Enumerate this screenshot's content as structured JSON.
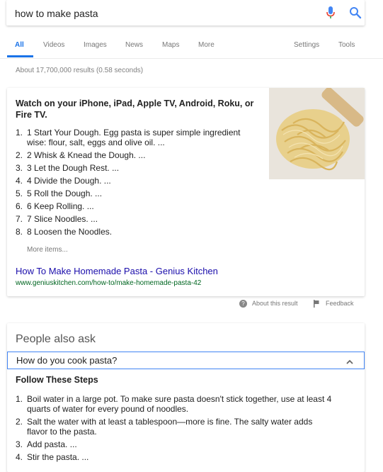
{
  "search": {
    "query": "how to make pasta"
  },
  "colors": {
    "accent": "#1a73e8",
    "link": "#1a0dab",
    "url": "#006621",
    "mic_blue": "#4285f4",
    "mic_red": "#ea4335"
  },
  "tabs": [
    {
      "label": "All",
      "active": true
    },
    {
      "label": "Videos"
    },
    {
      "label": "Images"
    },
    {
      "label": "News"
    },
    {
      "label": "Maps"
    },
    {
      "label": "More"
    },
    {
      "label": "Settings"
    },
    {
      "label": "Tools"
    }
  ],
  "result_stats": "About 17,700,000 results (0.58 seconds)",
  "featured": {
    "heading": "Watch on your iPhone, iPad, Apple TV, Android, Roku, or Fire TV.",
    "steps": [
      {
        "num": "1.",
        "text": "1 Start Your Dough. Egg pasta is super simple ingredient wise: flour, salt, eggs and olive oil. ..."
      },
      {
        "num": "2.",
        "text": "2 Whisk & Knead the Dough. ..."
      },
      {
        "num": "3.",
        "text": "3 Let the Dough Rest. ..."
      },
      {
        "num": "4.",
        "text": "4 Divide the Dough. ..."
      },
      {
        "num": "5.",
        "text": "5 Roll the Dough. ..."
      },
      {
        "num": "6.",
        "text": "6 Keep Rolling. ..."
      },
      {
        "num": "7.",
        "text": "7 Slice Noodles. ..."
      },
      {
        "num": "8.",
        "text": "8 Loosen the Noodles."
      }
    ],
    "more_items": "More items...",
    "link_title": "How To Make Homemade Pasta - Genius Kitchen",
    "url": "www.geniuskitchen.com/how-to/make-homemade-pasta-42"
  },
  "about": {
    "about_text": "About this result",
    "feedback_text": "Feedback",
    "about_icon": "?"
  },
  "paa": {
    "title": "People also ask",
    "question": "How do you cook pasta?",
    "answer_heading": "Follow These Steps",
    "steps": [
      {
        "num": "1.",
        "text": "Boil water in a large pot. To make sure pasta doesn't stick together, use at least 4 quarts of water for every pound of noodles."
      },
      {
        "num": "2.",
        "text": "Salt the water with at least a tablespoon—more is fine. The salty water adds flavor to the pasta."
      },
      {
        "num": "3.",
        "text": "Add pasta. ..."
      },
      {
        "num": "4.",
        "text": "Stir the pasta. ..."
      }
    ]
  }
}
